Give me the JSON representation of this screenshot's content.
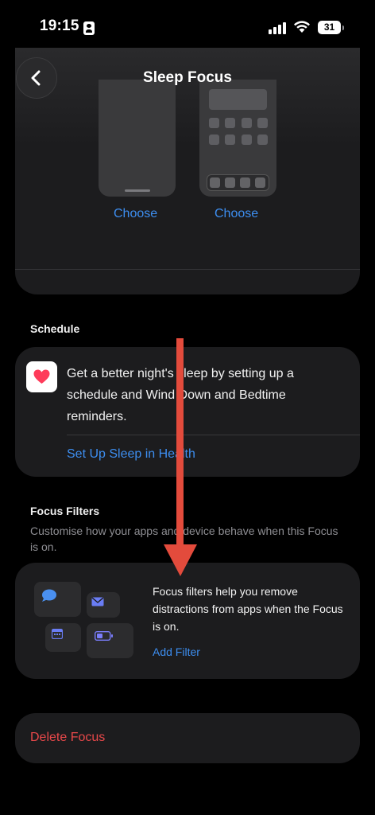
{
  "status_bar": {
    "time": "19:15",
    "battery": "31"
  },
  "header": {
    "title": "Sleep Focus"
  },
  "wallpapers": {
    "choose_lock": "Choose",
    "choose_home": "Choose"
  },
  "schedule": {
    "heading": "Schedule",
    "text": "Get a better night's sleep by setting up a schedule and Wind Down and Bedtime reminders.",
    "link": "Set Up Sleep in Health"
  },
  "focus_filters": {
    "heading": "Focus Filters",
    "description": "Customise how your apps and device behave when this Focus is on.",
    "card_text": "Focus filters help you remove distractions from apps when the Focus is on.",
    "link": "Add Filter"
  },
  "delete_focus": "Delete Focus",
  "colors": {
    "accent": "#3d8ef0",
    "destructive": "#e8484a",
    "annotation_arrow": "#e34b3c"
  }
}
